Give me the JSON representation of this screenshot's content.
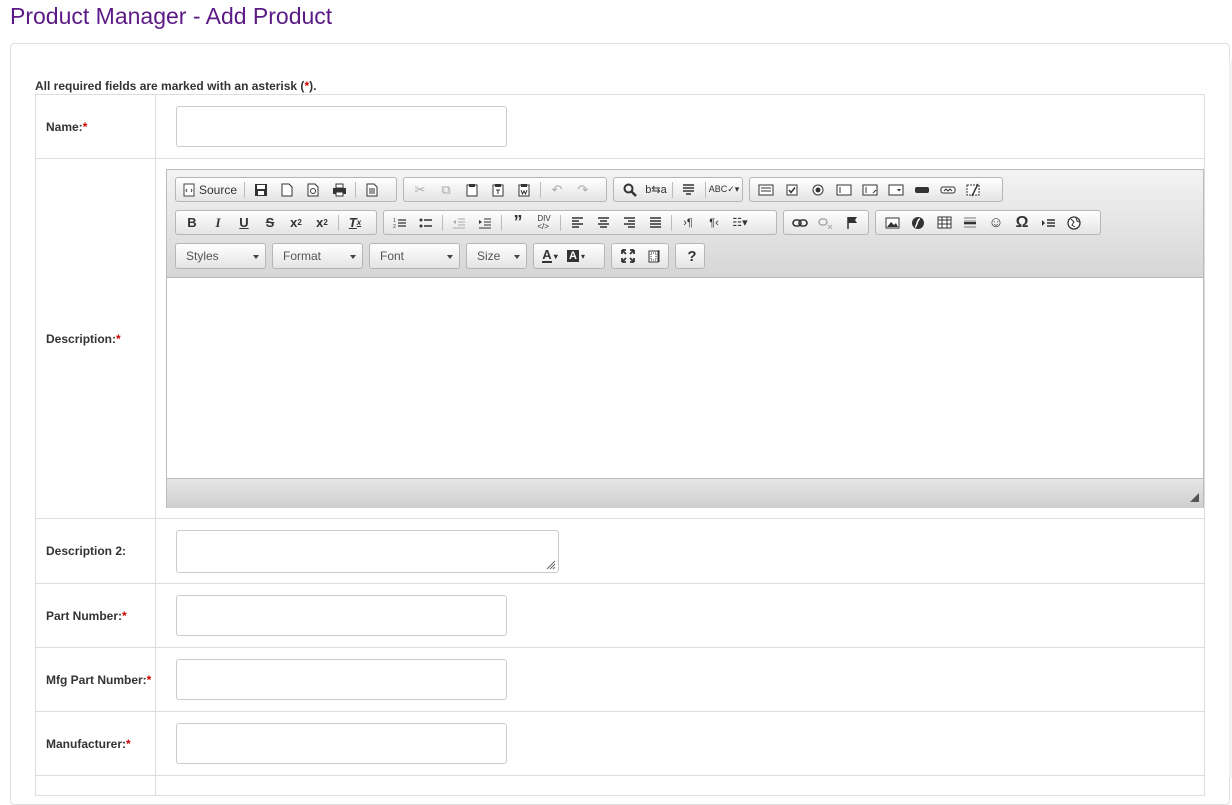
{
  "title": "Product Manager - Add Product",
  "required_note": {
    "text": "All required fields are marked with an asterisk (",
    "star": "*",
    "end": ")."
  },
  "fields": {
    "name": {
      "label": "Name:",
      "star": "*",
      "value": ""
    },
    "description": {
      "label": "Description:",
      "star": "*"
    },
    "description2": {
      "label": "Description 2:",
      "value": ""
    },
    "part_number": {
      "label": "Part Number:",
      "star": "*",
      "value": ""
    },
    "mfg_part_number": {
      "label": "Mfg Part Number:",
      "star": "*",
      "value": ""
    },
    "manufacturer": {
      "label": "Manufacturer:",
      "star": "*",
      "value": ""
    }
  },
  "editor": {
    "source_label": "Source",
    "styles_label": "Styles",
    "format_label": "Format",
    "font_label": "Font",
    "size_label": "Size",
    "help_label": "?"
  },
  "colors": {
    "title": "#5b1a86",
    "required_star": "#cc0000"
  }
}
